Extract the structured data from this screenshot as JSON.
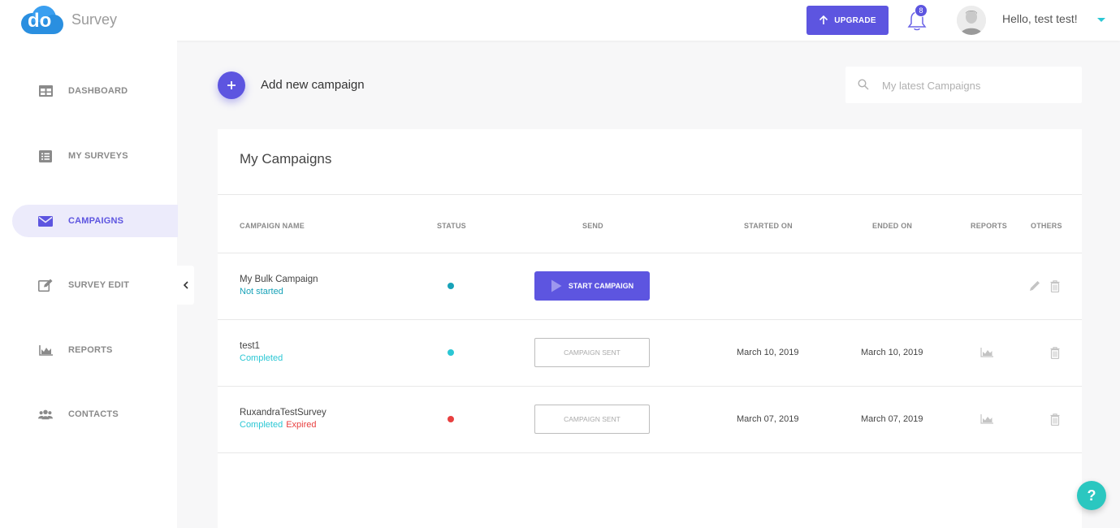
{
  "app": {
    "brand": "Survey",
    "logo_text": "do",
    "accent_color": "#5d55e0",
    "teal_color": "#2bc7d4"
  },
  "header": {
    "upgrade_label": "UPGRADE",
    "notification_count": "8",
    "greeting": "Hello, test test!"
  },
  "sidebar": {
    "items": [
      {
        "label": "DASHBOARD",
        "icon": "dashboard-icon"
      },
      {
        "label": "MY SURVEYS",
        "icon": "list-icon"
      },
      {
        "label": "CAMPAIGNS",
        "icon": "envelope-icon",
        "active": true
      },
      {
        "label": "SURVEY EDIT",
        "icon": "edit-icon"
      },
      {
        "label": "REPORTS",
        "icon": "area-chart-icon"
      },
      {
        "label": "CONTACTS",
        "icon": "users-icon"
      }
    ]
  },
  "main": {
    "add_campaign_label": "Add new campaign",
    "search_placeholder": "My latest Campaigns",
    "card_title": "My Campaigns",
    "columns": [
      "CAMPAIGN NAME",
      "STATUS",
      "SEND",
      "STARTED ON",
      "ENDED ON",
      "REPORTS",
      "OTHERS"
    ],
    "rows": [
      {
        "name": "My Bulk Campaign",
        "status": "Not started",
        "expired": "",
        "dot_color": "#17a2b8",
        "send": "START CAMPAIGN",
        "started": "",
        "ended": ""
      },
      {
        "name": "test1",
        "status": "Completed",
        "expired": "",
        "dot_color": "#2bc7d4",
        "send": "CAMPAIGN SENT",
        "started": "March 10, 2019",
        "ended": "March 10, 2019"
      },
      {
        "name": "RuxandraTestSurvey",
        "status": "Completed",
        "expired": "Expired",
        "dot_color": "#e84040",
        "send": "CAMPAIGN SENT",
        "started": "March 07, 2019",
        "ended": "March 07, 2019"
      }
    ]
  },
  "help_label": "?"
}
